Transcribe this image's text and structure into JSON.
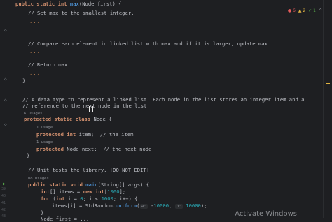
{
  "inspection": {
    "errors": "6",
    "warnings": "2",
    "checks": "1"
  },
  "lines": [
    {
      "segments": [
        [
          "kw",
          "public static int "
        ],
        [
          "fn",
          "max"
        ],
        [
          "cm",
          "(Node first) {"
        ]
      ]
    },
    {
      "segments": [
        [
          "cm",
          "// Set max to the smallest integer."
        ]
      ]
    },
    {
      "segments": [
        [
          "fold",
          "..."
        ]
      ]
    },
    {
      "segments": [
        [
          "cm",
          "// Compare each element in linked list with max and if it is larger, update max."
        ]
      ]
    },
    {
      "segments": [
        [
          "fold",
          "..."
        ]
      ]
    },
    {
      "segments": [
        [
          "cm",
          "// Return max."
        ]
      ]
    },
    {
      "segments": [
        [
          "fold",
          "..."
        ]
      ]
    },
    {
      "segments": [
        [
          "cm",
          "}"
        ]
      ]
    },
    {
      "segments": [
        [
          "cm",
          "// A data type to represent a linked list. Each node in the list stores an integer item and a"
        ]
      ]
    },
    {
      "segments": [
        [
          "cm",
          "// reference to the next node in the list."
        ]
      ]
    },
    {
      "segments": [
        [
          "hint",
          "6 usages"
        ]
      ]
    },
    {
      "segments": [
        [
          "kw",
          "protected static class "
        ],
        [
          "cm",
          "Node {"
        ]
      ]
    },
    {
      "segments": [
        [
          "hint",
          "1 usage"
        ]
      ]
    },
    {
      "segments": [
        [
          "kw",
          "protected int "
        ],
        [
          "cm",
          "item;  // the item"
        ]
      ]
    },
    {
      "segments": [
        [
          "hint",
          "1 usage"
        ]
      ]
    },
    {
      "segments": [
        [
          "kw",
          "protected "
        ],
        [
          "cm",
          "Node "
        ],
        [
          "cm",
          "next"
        ],
        [
          "cm",
          ";  // the next node"
        ]
      ]
    },
    {
      "segments": [
        [
          "cm",
          "}"
        ]
      ]
    },
    {
      "segments": [
        [
          "cm",
          "// Unit tests the library. [DO NOT EDIT]"
        ]
      ]
    },
    {
      "segments": [
        [
          "hint",
          "no usages"
        ]
      ]
    },
    {
      "segments": [
        [
          "kw",
          "public static void "
        ],
        [
          "fn",
          "main"
        ],
        [
          "cm",
          "(String[] args) {"
        ]
      ]
    },
    {
      "segments": [
        [
          "kw",
          "int"
        ],
        [
          "cm",
          "[] items = "
        ],
        [
          "kw",
          "new int"
        ],
        [
          "cm",
          "["
        ],
        [
          "num",
          "1000"
        ],
        [
          "cm",
          "];"
        ]
      ]
    },
    {
      "segments": [
        [
          "kw",
          "for "
        ],
        [
          "cm",
          "("
        ],
        [
          "kw",
          "int "
        ],
        [
          "cm",
          "i = "
        ],
        [
          "num",
          "0"
        ],
        [
          "cm",
          "; i < "
        ],
        [
          "num",
          "1000"
        ],
        [
          "cm",
          "; i++) {"
        ]
      ]
    },
    {
      "segments": [
        [
          "cm",
          "items[i] = StdRandom."
        ],
        [
          "fn",
          "uniform"
        ],
        [
          "cm",
          "("
        ],
        [
          "param",
          "a:"
        ],
        [
          "cm",
          " -"
        ],
        [
          "num",
          "10000"
        ],
        [
          "cm",
          ", "
        ],
        [
          "param",
          "b:"
        ],
        [
          "cm",
          " "
        ],
        [
          "num",
          "10000"
        ],
        [
          "cm",
          ");"
        ]
      ]
    },
    {
      "segments": [
        [
          "cm",
          "}"
        ]
      ]
    },
    {
      "segments": [
        [
          "cm",
          "Node first = ..."
        ]
      ]
    }
  ],
  "watermark": "Activate Windows"
}
